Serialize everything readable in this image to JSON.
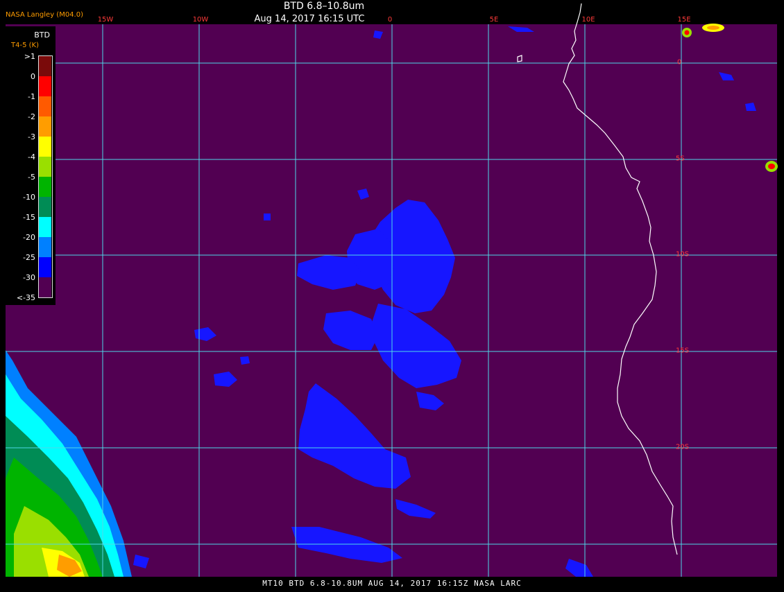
{
  "header": {
    "title": "BTD 6.8–10.8um",
    "subtitle": "Aug 14, 2017 16:15 UTC",
    "provider": "NASA Langley (M04.0)"
  },
  "footer": {
    "caption": "MT10  BTD 6.8-10.8UM  AUG 14, 2017 16:15Z  NASA LARC"
  },
  "legend": {
    "title": "BTD",
    "subtitle": "T4-5 (K)",
    "entries": [
      {
        "label": ">1",
        "color": "#7a0a0a"
      },
      {
        "label": "0",
        "color": "#ff0000"
      },
      {
        "label": "-1",
        "color": "#ff5a00"
      },
      {
        "label": "-2",
        "color": "#ff9d00"
      },
      {
        "label": "-3",
        "color": "#ffff00"
      },
      {
        "label": "-4",
        "color": "#9adf00"
      },
      {
        "label": "-5",
        "color": "#00b400"
      },
      {
        "label": "-10",
        "color": "#008c55"
      },
      {
        "label": "-15",
        "color": "#00ffff"
      },
      {
        "label": "-20",
        "color": "#0080ff"
      },
      {
        "label": "-25",
        "color": "#0000ff"
      },
      {
        "label": "-30",
        "color": "#520052"
      },
      {
        "label": "<-35",
        "color": ""
      }
    ]
  },
  "map": {
    "background_color": "#520052",
    "gridline_color": "#4ed8e8",
    "coast_color": "#ffffff",
    "grid_label_color": "#ff3a3a",
    "longitude_labels": [
      "15W",
      "10W",
      "0",
      "5E",
      "10E",
      "15E"
    ],
    "latitude_labels": [
      "0",
      "5S",
      "10S",
      "15S",
      "20S"
    ]
  }
}
